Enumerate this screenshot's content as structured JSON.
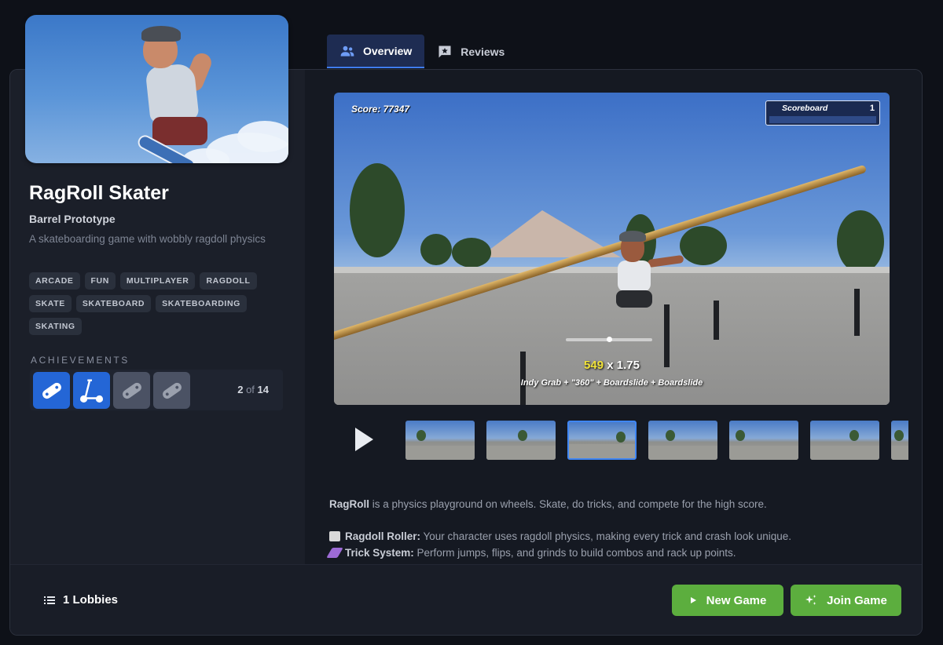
{
  "tabs": [
    {
      "label": "Overview",
      "icon": "users-icon",
      "active": true
    },
    {
      "label": "Reviews",
      "icon": "review-icon",
      "active": false
    }
  ],
  "game": {
    "title": "RagRoll Skater",
    "developer": "Barrel Prototype",
    "short_description": "A skateboarding game with wobbly ragdoll physics",
    "tags": [
      "ARCADE",
      "FUN",
      "MULTIPLAYER",
      "RAGDOLL",
      "SKATE",
      "SKATEBOARD",
      "SKATEBOARDING",
      "SKATING"
    ]
  },
  "achievements": {
    "label": "ACHIEVEMENTS",
    "unlocked": "2",
    "of": "of",
    "total": "14",
    "badges": [
      {
        "icon": "skateboard-icon",
        "unlocked": true
      },
      {
        "icon": "scooter-icon",
        "unlocked": true
      },
      {
        "icon": "skateboard-icon",
        "unlocked": false
      },
      {
        "icon": "skateboard-icon",
        "unlocked": false
      }
    ]
  },
  "media": {
    "score_text": "Score: 77347",
    "scoreboard_title": "Scoreboard",
    "scoreboard_count": "1",
    "combo_points": "549",
    "combo_multiplier": " x 1.75",
    "combo_tricks": "Indy Grab + \"360\" + Boardslide + Boardslide",
    "thumbnail_count": 7,
    "selected_thumbnail": 3
  },
  "about": {
    "intro_bold": "RagRoll",
    "intro_rest": " is a physics playground on wheels. Skate, do tricks, and compete for the high score.",
    "features": [
      {
        "name": "Ragdoll Roller:",
        "text": " Your character uses ragdoll physics, making every trick and crash look unique.",
        "icon_color": "#d9d9d9"
      },
      {
        "name": "Trick System:",
        "text": " Perform jumps, flips, and grinds to build combos and rack up points.",
        "icon_color": "#9d6bd6"
      }
    ]
  },
  "footer": {
    "lobbies": "1 Lobbies",
    "new_game": "New Game",
    "join_game": "Join Game"
  },
  "colors": {
    "accent_blue": "#3f7cf0",
    "button_green": "#5cae3e",
    "combo_yellow": "#f1e33a"
  }
}
